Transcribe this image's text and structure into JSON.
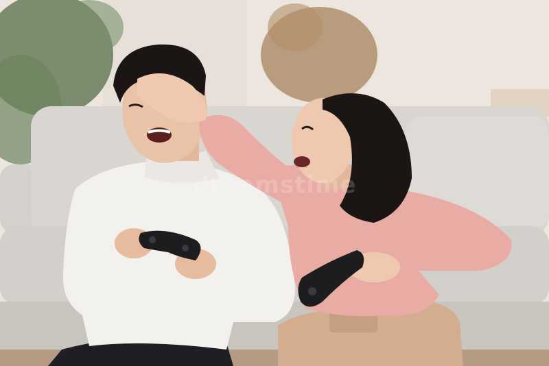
{
  "photo": {
    "description_key": "couple-playing-video-games-on-couch",
    "colors": {
      "wall": "#ece6df",
      "sofa": "#d9d6d1",
      "sofa_shadow": "#c8c4be",
      "plant": "#5f7552",
      "dried_flowers": "#a8825e",
      "man_sweater": "#f3f1ee",
      "woman_sweater": "#e9aca4",
      "woman_pants": "#d4ad8f",
      "hair": "#1b1614",
      "skin": "#e9c3a8",
      "controller": "#1d1d1f",
      "man_pants": "#1f1f23",
      "floor": "#b59b84"
    },
    "watermark": "dreamstime"
  }
}
